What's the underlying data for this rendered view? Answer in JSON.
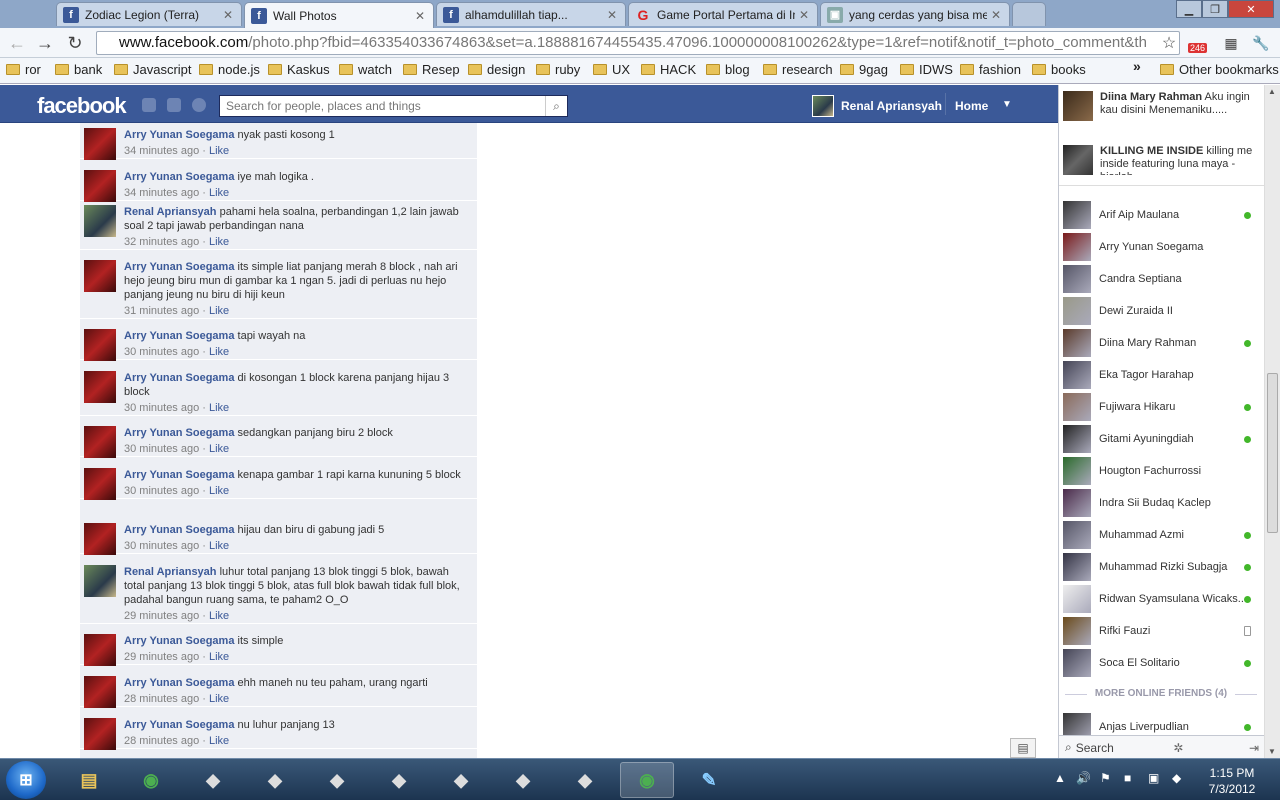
{
  "browser": {
    "tabs": [
      {
        "title": "Zodiac Legion (Terra)",
        "icon": "facebook-icon",
        "active": false
      },
      {
        "title": "Wall Photos",
        "icon": "facebook-icon",
        "active": true
      },
      {
        "title": "alhamdulillah tiap...",
        "icon": "facebook-icon",
        "active": false
      },
      {
        "title": "Game Portal Pertama di In...",
        "icon": "gemscool-icon",
        "active": false
      },
      {
        "title": "yang cerdas yang bisa men...",
        "icon": "page-icon",
        "active": false
      }
    ],
    "url_domain": "www.facebook.com",
    "url_path": "/photo.php?fbid=463354033674863&set=a.188881674455435.47096.100000008100262&type=1&ref=notif&notif_t=photo_comment&th",
    "extension_badge": "246",
    "bookmarks": [
      "ror",
      "bank",
      "Javascript",
      "node.js",
      "Kaskus",
      "watch",
      "Resep",
      "design",
      "ruby",
      "UX",
      "HACK",
      "blog",
      "research",
      "9gag",
      "IDWS",
      "fashion",
      "books"
    ],
    "bookmarks_more": "»",
    "other_bookmarks": "Other bookmarks"
  },
  "facebook": {
    "logo": "facebook",
    "search_placeholder": "Search for people, places and things",
    "user_name": "Renal Apriansyah",
    "home_label": "Home"
  },
  "comments": [
    {
      "author": "Arry Yunan Soegama",
      "text": "nyak pasti kosong 1",
      "time": "34 minutes ago",
      "like": "Like",
      "avatar": "arry"
    },
    {
      "author": "Arry Yunan Soegama",
      "text": "iye mah logika .",
      "time": "34 minutes ago",
      "like": "Like",
      "avatar": "arry"
    },
    {
      "author": "Renal Apriansyah",
      "text": "pahami hela soalna, perbandingan 1,2 lain jawab soal 2 tapi jawab perbandingan nana",
      "time": "32 minutes ago",
      "like": "Like",
      "avatar": "renal"
    },
    {
      "author": "Arry Yunan Soegama",
      "text": "its simple liat panjang merah 8 block , nah ari hejo jeung biru mun di gambar ka 1 ngan 5. jadi di perluas nu hejo panjang jeung nu biru di hiji keun",
      "time": "31 minutes ago",
      "like": "Like",
      "avatar": "arry"
    },
    {
      "author": "Arry Yunan Soegama",
      "text": "tapi wayah na",
      "time": "30 minutes ago",
      "like": "Like",
      "avatar": "arry"
    },
    {
      "author": "Arry Yunan Soegama",
      "text": "di kosongan 1 block karena panjang hijau 3 block",
      "time": "30 minutes ago",
      "like": "Like",
      "avatar": "arry"
    },
    {
      "author": "Arry Yunan Soegama",
      "text": "sedangkan panjang biru 2 block",
      "time": "30 minutes ago",
      "like": "Like",
      "avatar": "arry"
    },
    {
      "author": "Arry Yunan Soegama",
      "text": "kenapa gambar 1 rapi karna kununing 5 block",
      "time": "30 minutes ago",
      "like": "Like",
      "avatar": "arry"
    },
    {
      "author": "Arry Yunan Soegama",
      "text": "hijau dan biru di gabung jadi 5",
      "time": "30 minutes ago",
      "like": "Like",
      "avatar": "arry"
    },
    {
      "author": "Renal Apriansyah",
      "text": "luhur total panjang 13 blok tinggi 5 blok, bawah total panjang 13 blok tinggi 5 blok, atas full blok bawah tidak full blok, padahal bangun ruang sama, te paham2 O_O",
      "time": "29 minutes ago",
      "like": "Like",
      "avatar": "renal"
    },
    {
      "author": "Arry Yunan Soegama",
      "text": "its simple",
      "time": "29 minutes ago",
      "like": "Like",
      "avatar": "arry"
    },
    {
      "author": "Arry Yunan Soegama",
      "text": "ehh maneh nu teu paham, urang ngarti",
      "time": "28 minutes ago",
      "like": "Like",
      "avatar": "arry"
    },
    {
      "author": "Arry Yunan Soegama",
      "text": "nu luhur panjang 13",
      "time": "28 minutes ago",
      "like": "Like",
      "avatar": "arry"
    }
  ],
  "ticker": [
    {
      "author": "Diina Mary Rahman",
      "text": "Aku ingin kau disini Menemaniku....."
    },
    {
      "author": "KILLING ME INSIDE",
      "text": "killing me inside featuring luna maya - biarlah"
    }
  ],
  "friends": [
    {
      "name": "Arif Aip Maulana",
      "status": "online"
    },
    {
      "name": "Arry Yunan Soegama",
      "status": "none"
    },
    {
      "name": "Candra Septiana",
      "status": "none"
    },
    {
      "name": "Dewi Zuraida II",
      "status": "none"
    },
    {
      "name": "Diina Mary Rahman",
      "status": "online"
    },
    {
      "name": "Eka Tagor Harahap",
      "status": "none"
    },
    {
      "name": "Fujiwara Hikaru",
      "status": "online"
    },
    {
      "name": "Gitami Ayuningdiah",
      "status": "online"
    },
    {
      "name": "Hougton Fachurrossi",
      "status": "none"
    },
    {
      "name": "Indra Sii Budaq Kaclep",
      "status": "none"
    },
    {
      "name": "Muhammad Azmi",
      "status": "online"
    },
    {
      "name": "Muhammad Rizki Subagja",
      "status": "online"
    },
    {
      "name": "Ridwan Syamsulana Wicaks...",
      "status": "online"
    },
    {
      "name": "Rifki Fauzi",
      "status": "mobile"
    },
    {
      "name": "Soca El Solitario",
      "status": "online"
    }
  ],
  "more_online": "MORE ONLINE FRIENDS (4)",
  "more_friends": [
    {
      "name": "Anjas Liverpudlian",
      "status": "online"
    }
  ],
  "chat_search": "Search",
  "clock": {
    "time": "1:15 PM",
    "date": "7/3/2012"
  },
  "taskbar": [
    "explorer-icon",
    "chrome-icon",
    "app-icon",
    "app-icon",
    "app-icon",
    "app-icon",
    "app-icon",
    "app-icon",
    "app-icon",
    "chrome-icon",
    "paint-icon"
  ]
}
